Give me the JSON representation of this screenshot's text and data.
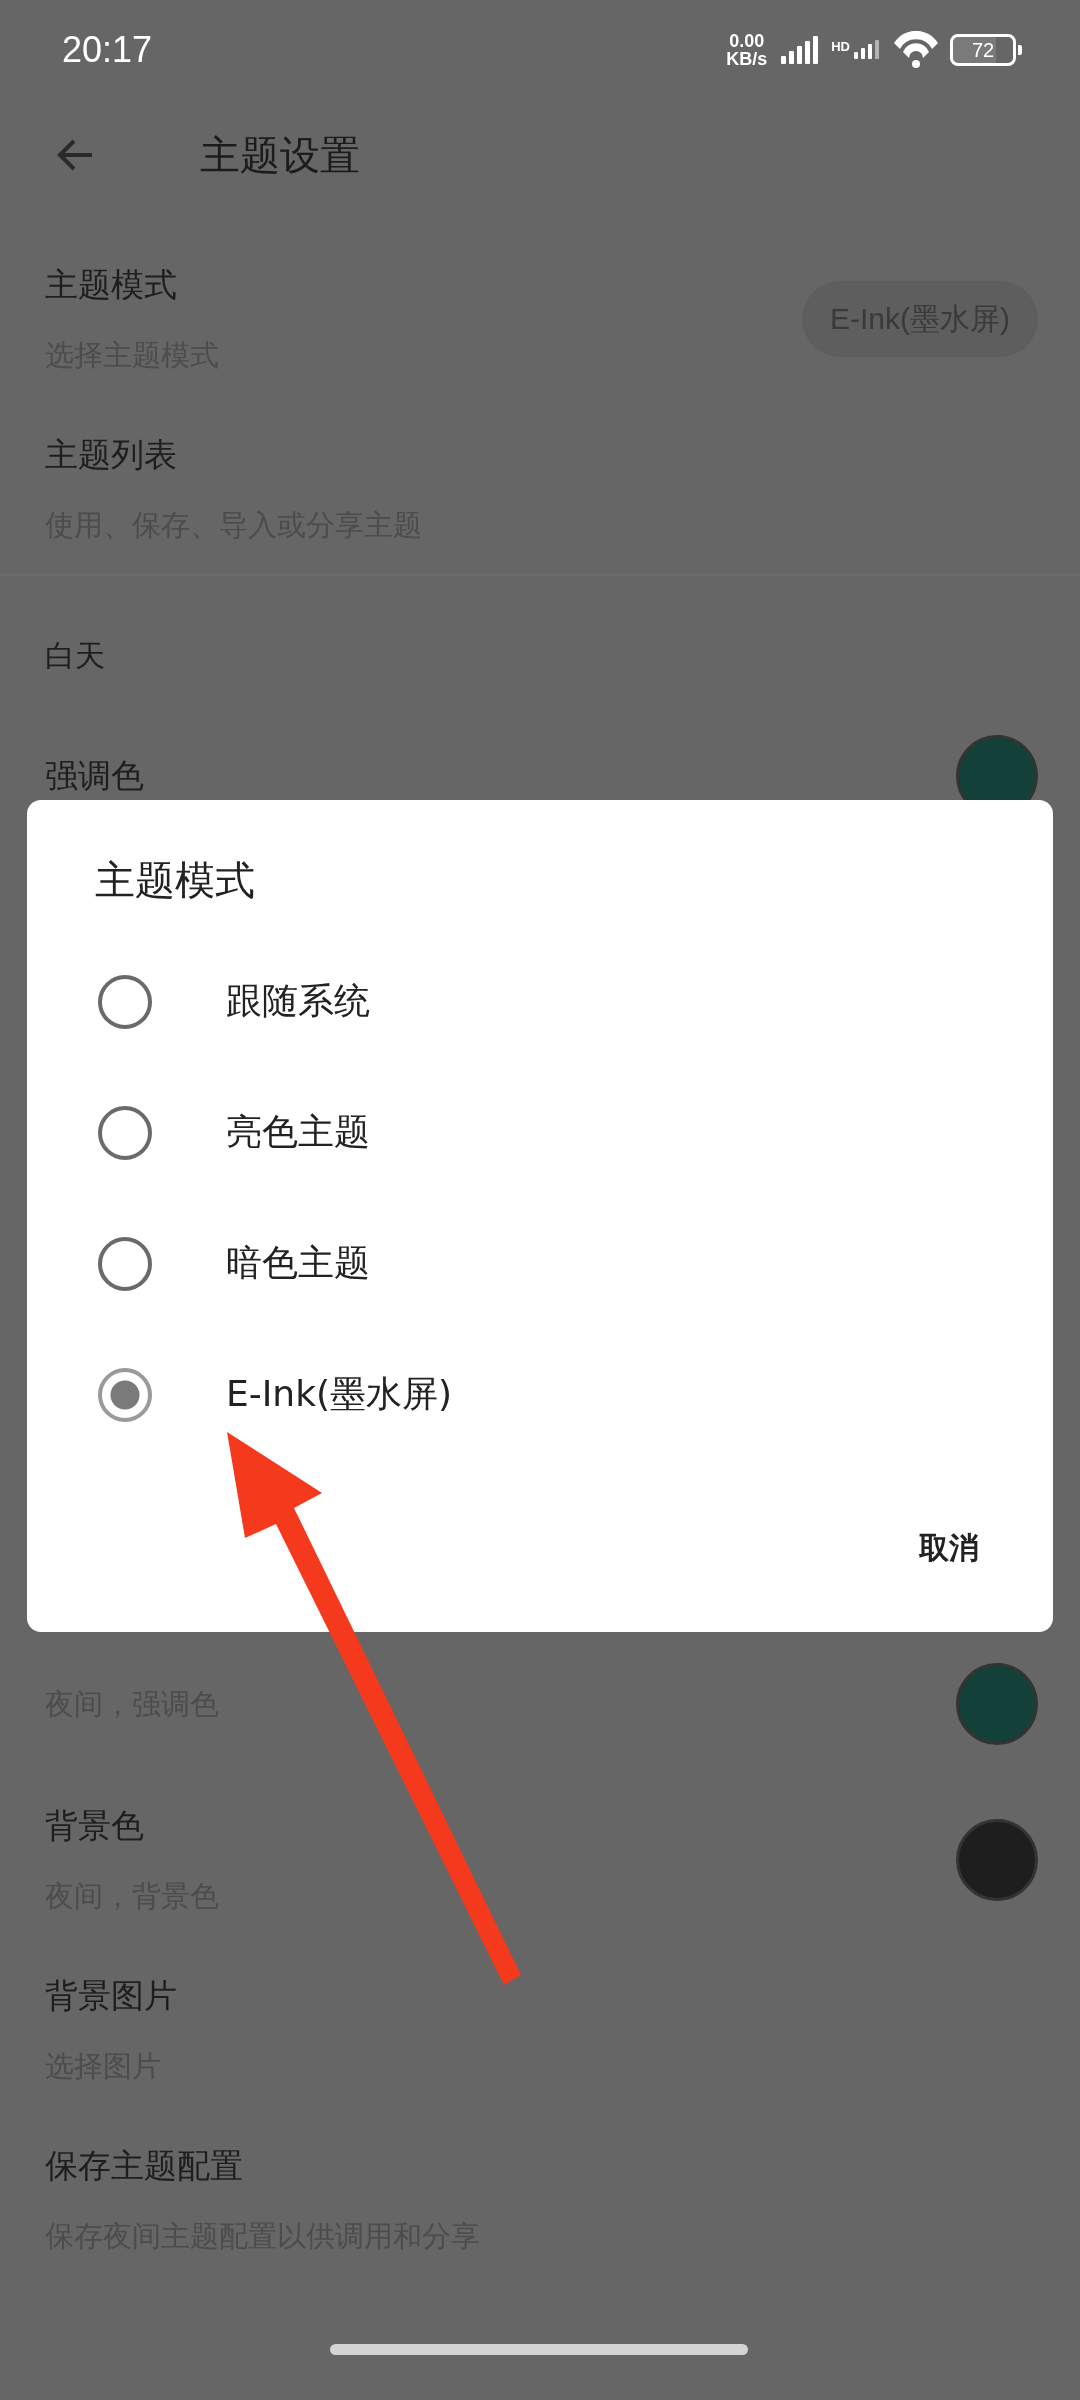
{
  "status_bar": {
    "time": "20:17",
    "net_speed": "0.00",
    "net_unit": "KB/s",
    "sim_label": "HD",
    "battery": "72"
  },
  "app_bar": {
    "title": "主题设置"
  },
  "settings": [
    {
      "title": "主题模式",
      "subtitle": "选择主题模式",
      "value": "E-Ink(墨水屏)"
    },
    {
      "title": "主题列表",
      "subtitle": "使用、保存、导入或分享主题"
    }
  ],
  "day_section": {
    "header": "白天",
    "items": [
      {
        "title": "强调色",
        "color": "#134039"
      }
    ]
  },
  "night_items": [
    {
      "subtitle": "夜间，强调色",
      "color": "#134039"
    },
    {
      "title": "背景色",
      "subtitle": "夜间，背景色",
      "color": "#1e1e1e"
    },
    {
      "title": "背景图片",
      "subtitle": "选择图片"
    },
    {
      "title": "保存主题配置",
      "subtitle": "保存夜间主题配置以供调用和分享"
    }
  ],
  "dialog": {
    "title": "主题模式",
    "options": [
      {
        "label": "跟随系统",
        "selected": false
      },
      {
        "label": "亮色主题",
        "selected": false
      },
      {
        "label": "暗色主题",
        "selected": false
      },
      {
        "label": "E-Ink(墨水屏)",
        "selected": true
      }
    ],
    "buttons": [
      "取消"
    ]
  }
}
